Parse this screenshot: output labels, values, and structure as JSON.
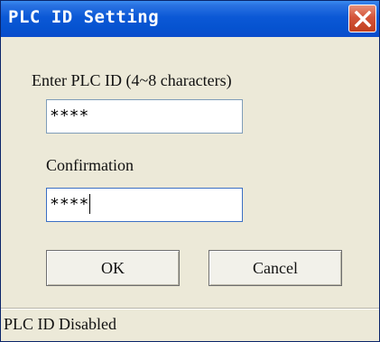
{
  "window": {
    "title": "PLC ID Setting"
  },
  "form": {
    "plc_id_label": "Enter PLC ID (4~8 characters)",
    "plc_id_value": "****",
    "confirmation_label": "Confirmation",
    "confirmation_value": "****"
  },
  "buttons": {
    "ok": "OK",
    "cancel": "Cancel"
  },
  "status": {
    "text": "PLC ID Disabled"
  },
  "icons": {
    "close": "close-icon"
  },
  "colors": {
    "titlebar": "#0653d0",
    "close_button": "#c1401f",
    "dialog_background": "#ece9d8"
  }
}
